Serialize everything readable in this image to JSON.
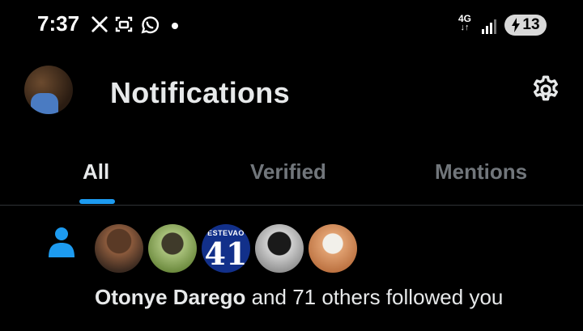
{
  "status_bar": {
    "time": "7:37",
    "notification_icons": [
      "x-logo-icon",
      "screenshot-icon",
      "whatsapp-icon",
      "dot-icon"
    ],
    "network": "4G",
    "battery_level": "13",
    "battery_charging": true
  },
  "header": {
    "title": "Notifications",
    "settings_icon": "gear-icon"
  },
  "tabs": [
    {
      "label": "All",
      "active": true
    },
    {
      "label": "Verified",
      "active": false
    },
    {
      "label": "Mentions",
      "active": false
    }
  ],
  "colors": {
    "accent": "#1d9bf0",
    "background": "#000000",
    "text": "#e7e9ea",
    "muted": "#71767b"
  },
  "notification": {
    "type_icon": "person-icon",
    "avatars": [
      {
        "name": "follower-avatar"
      },
      {
        "name": "follower-avatar"
      },
      {
        "name": "follower-avatar",
        "jersey_name": "ESTEVAO",
        "jersey_number": "41"
      },
      {
        "name": "follower-avatar"
      },
      {
        "name": "follower-avatar"
      }
    ],
    "actor": "Otonye Darego",
    "rest": " and 71 others followed you"
  }
}
